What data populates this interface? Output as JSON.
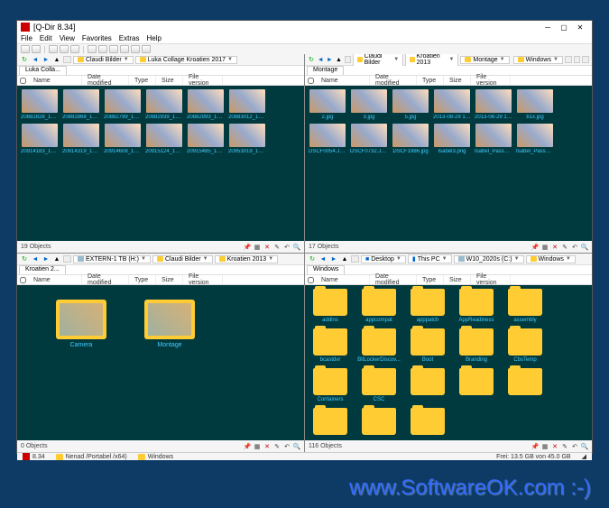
{
  "window": {
    "title": "[Q-Dir 8.34]"
  },
  "menu": {
    "file": "File",
    "edit": "Edit",
    "view": "View",
    "favorites": "Favorites",
    "extras": "Extras",
    "help": "Help"
  },
  "cols": {
    "name": "Name",
    "date": "Date modified",
    "type": "Type",
    "size": "Size",
    "version": "File version"
  },
  "pane1": {
    "crumbs": [
      "Claudi Bilder",
      "Luka Collage Kroatien 2017"
    ],
    "tab": "Luka Colla...",
    "items": [
      "20882828_15316...",
      "20882868_15316...",
      "20882799_15316...",
      "20882939_15318...",
      "20882993_15318...",
      "20883012_15328...",
      "20914183_15316...",
      "20914319_15316...",
      "20914608_15316...",
      "20915124_15328...",
      "20915485_15318...",
      "20953019_15328..."
    ],
    "status": "19 Objects"
  },
  "pane2": {
    "crumbs": [
      "Claudi Bilder",
      "Kroatien 2013",
      "Montage"
    ],
    "crumb_extra": "Windows",
    "tab": "Montage",
    "items": [
      "2.jpg",
      "3.jpg",
      "5.jpg",
      "2013-08-29 17.35.25.jpg",
      "2013-08-29 17.35.49.jpg",
      "b1x.jpg",
      "DSCF0054.JPG",
      "DSCF0732.JPG",
      "DSCF1986.jpg",
      "Isabel3.png",
      "Isabel_Passbild_1...",
      "Isabel_Passbild_1..."
    ],
    "status": "17 Objects"
  },
  "pane3": {
    "crumbs_drive": "EXTERN-1 TB (H:)",
    "crumbs": [
      "Claudi Bilder",
      "Kroatien 2013"
    ],
    "tab": "Kroatien 2...",
    "items": [
      "Camera",
      "Montage"
    ],
    "status": "0 Objects"
  },
  "pane4": {
    "crumbs": [
      "Desktop",
      "This PC",
      "W10_2020s (C:)",
      "Windows"
    ],
    "tab": "Windows",
    "items": [
      "addins",
      "appcompat",
      "apppatch",
      "AppReadiness",
      "assembly",
      "bcastdvr",
      "BitLockerDiscov...",
      "Boot",
      "Branding",
      "CbsTemp",
      "Containers",
      "CSC"
    ],
    "status": "116 Objects"
  },
  "status": {
    "version": "8.34",
    "user": "Nenad /Portabel /x64)",
    "folder": "Windows",
    "disk": "Frei: 13.5 GB von 45.0 GB"
  },
  "watermark": "www.SoftwareOK.com :-)"
}
